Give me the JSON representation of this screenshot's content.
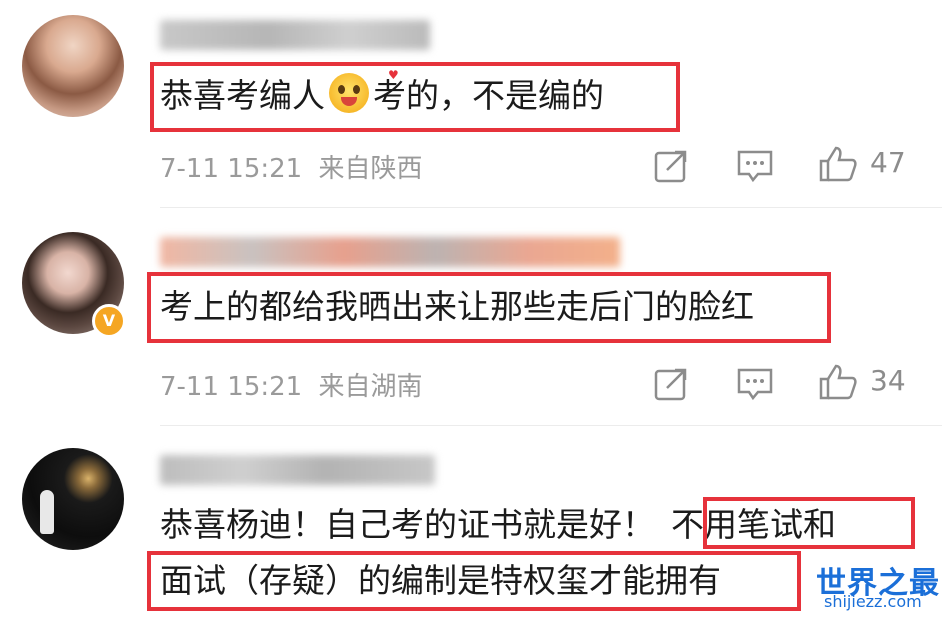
{
  "comments": [
    {
      "text_line1": "恭喜考编人",
      "text_line1_after_emoji": "考的，不是编的",
      "emoji_icon": "grinning-face-emoji",
      "timestamp": "7-11 15:21",
      "location": "来自陕西",
      "like_count": "47"
    },
    {
      "text_line1": "考上的都给我晒出来让那些走后门的脸红",
      "timestamp": "7-11 15:21",
      "location": "来自湖南",
      "like_count": "34"
    },
    {
      "text_line1_plain": "恭喜杨迪！自己考的证书就是好！",
      "text_line1_highlight": "不用笔试和",
      "text_line2": "面试（存疑）的编制是特权玺才能拥有"
    }
  ],
  "watermark": {
    "title": "世界之最",
    "domain": "shijiezz.com"
  },
  "colors": {
    "highlight_border": "#e6323b",
    "meta_text": "#9a9a9a",
    "watermark": "#1b6fd8"
  }
}
